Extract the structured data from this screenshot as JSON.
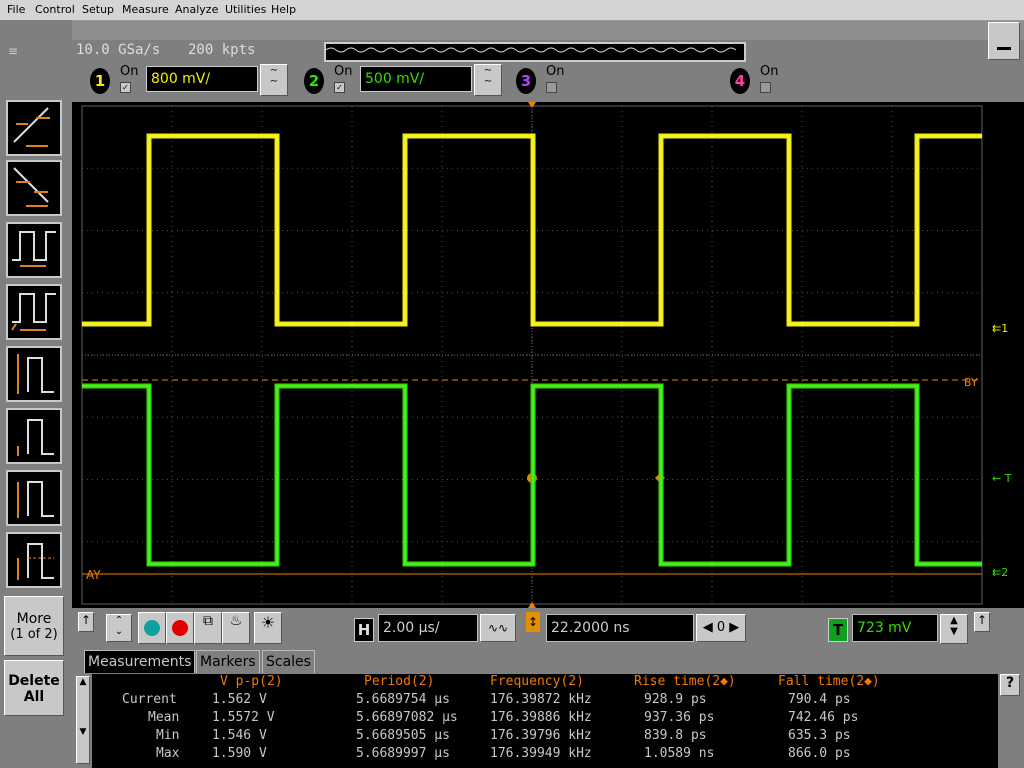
{
  "menu": [
    "File",
    "Control",
    "Setup",
    "Measure",
    "Analyze",
    "Utilities",
    "Help"
  ],
  "acquisition": {
    "rate": "10.0 GSa/s",
    "points": "200 kpts"
  },
  "channels": [
    {
      "num": "1",
      "on": "On",
      "scale": "800 mV/",
      "color": "#f0f000"
    },
    {
      "num": "2",
      "on": "On",
      "scale": "500 mV/",
      "color": "#30e000"
    },
    {
      "num": "3",
      "on": "On",
      "color": "#b040ff"
    },
    {
      "num": "4",
      "on": "On",
      "color": "#ff40a0"
    }
  ],
  "sidebar": {
    "more_label": "More",
    "more_page": "(1 of 2)",
    "delete_label": "Delete",
    "delete_label2": "All"
  },
  "markers": {
    "ch1": "1",
    "ch2": "2",
    "trigger": "T",
    "bY": "BY",
    "aY": "AY"
  },
  "horizontal": {
    "h_label": "H",
    "time_per_div": "2.00 µs/",
    "delay": "22.2000 ns",
    "zero": "0"
  },
  "trigger": {
    "label": "T",
    "level": "723 mV"
  },
  "tabs": [
    "Measurements",
    "Markers",
    "Scales"
  ],
  "measurements": {
    "headers": [
      "V p-p(2)",
      "Period(2)",
      "Frequency(2)",
      "Rise time(2◆)",
      "Fall time(2◆)"
    ],
    "rows": [
      {
        "label": "Current",
        "values": [
          "1.562 V",
          "5.6689754 µs",
          "176.39872 kHz",
          "928.9 ps",
          "790.4 ps"
        ]
      },
      {
        "label": "Mean",
        "values": [
          "1.5572 V",
          "5.66897082 µs",
          "176.39886 kHz",
          "937.36 ps",
          "742.46 ps"
        ]
      },
      {
        "label": "Min",
        "values": [
          "1.546 V",
          "5.6689505 µs",
          "176.39796 kHz",
          "839.8 ps",
          "635.3 ps"
        ]
      },
      {
        "label": "Max",
        "values": [
          "1.590 V",
          "5.6689997 µs",
          "176.39949 kHz",
          "1.0589 ns",
          "866.0 ps"
        ]
      }
    ]
  },
  "help_label": "?",
  "colors": {
    "ch1": "#f0f000",
    "ch2": "#30e000",
    "marker": "#f08000",
    "grid": "#505050"
  }
}
